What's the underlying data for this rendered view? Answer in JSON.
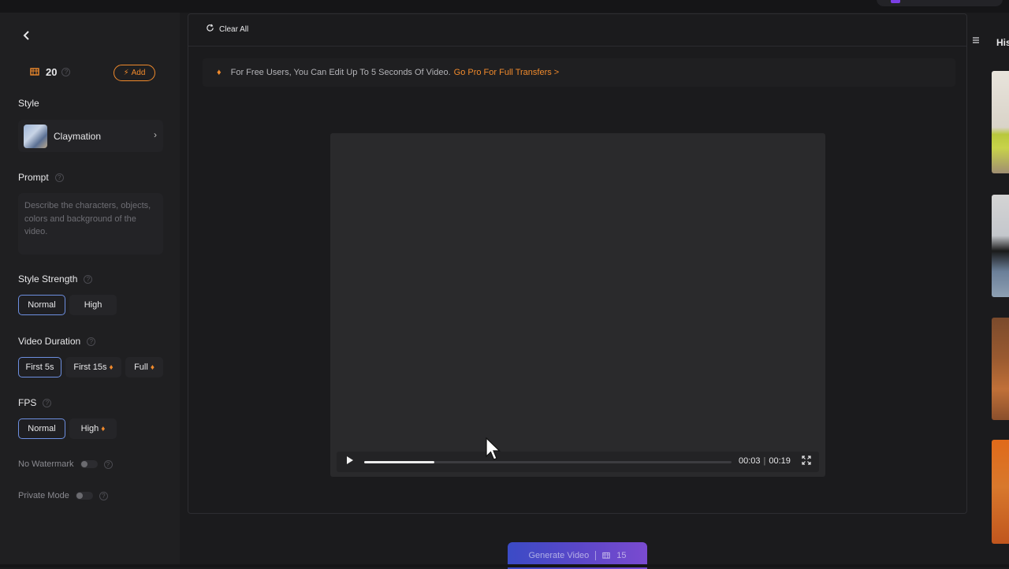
{
  "credits": {
    "amount": "20",
    "add_label": "Add"
  },
  "style": {
    "section_label": "Style",
    "selected_name": "Claymation"
  },
  "prompt": {
    "section_label": "Prompt",
    "placeholder": "Describe the characters, objects, colors and background of the video."
  },
  "style_strength": {
    "section_label": "Style Strength",
    "options": [
      "Normal",
      "High"
    ],
    "selected": "Normal"
  },
  "video_duration": {
    "section_label": "Video Duration",
    "options": [
      "First 5s",
      "First 15s",
      "Full"
    ],
    "selected": "First 5s"
  },
  "fps": {
    "section_label": "FPS",
    "options": [
      "Normal",
      "High"
    ],
    "selected": "Normal"
  },
  "toggles": {
    "no_watermark": "No Watermark",
    "private_mode": "Private Mode"
  },
  "toolbar": {
    "clear_all": "Clear All"
  },
  "notice": {
    "text": "For Free Users, You Can Edit Up To 5 Seconds Of Video.",
    "link": "Go Pro For Full Transfers >"
  },
  "player": {
    "current_time": "00:03",
    "total_time": "00:19",
    "progress_fraction": 0.19
  },
  "generate": {
    "label": "Generate Video",
    "cost": "15"
  },
  "history": {
    "title": "His"
  },
  "colors": {
    "accent_orange": "#f08a2c",
    "active_border": "#6d8fe0",
    "generate_gradient_start": "#3b4bc6",
    "generate_gradient_end": "#7a4bd0"
  }
}
